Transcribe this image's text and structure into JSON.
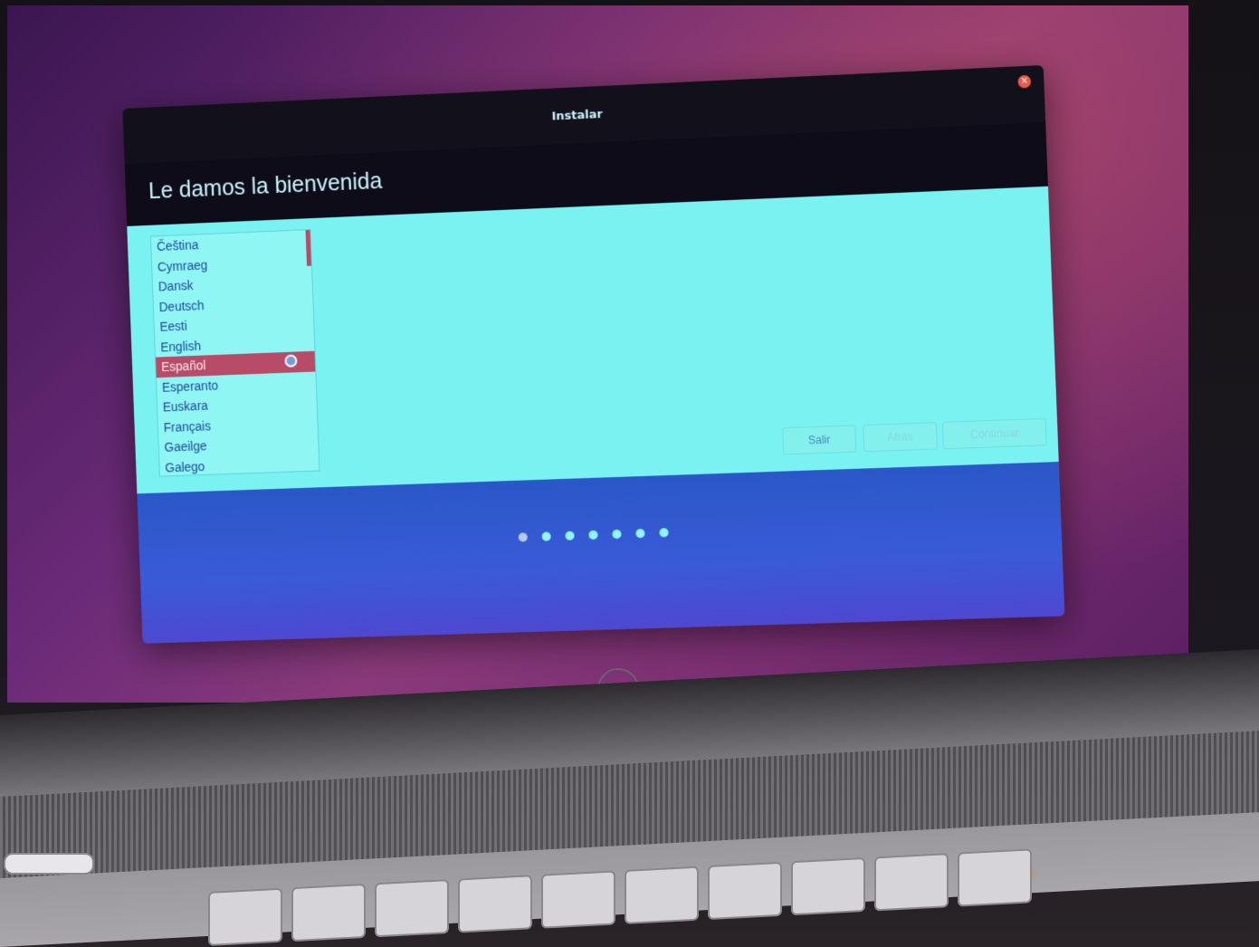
{
  "window": {
    "title": "Instalar",
    "heading": "Le damos la bienvenida"
  },
  "languages": [
    "Čeština",
    "Cymraeg",
    "Dansk",
    "Deutsch",
    "Eesti",
    "English",
    "Español",
    "Esperanto",
    "Euskara",
    "Français",
    "Gaeilge",
    "Galego"
  ],
  "selected_language": "Español",
  "buttons": {
    "quit": "Salir",
    "back": "Atrás",
    "continue": "Continuar"
  },
  "progress": {
    "total_steps": 7,
    "current_step": 1
  },
  "colors": {
    "accent": "#b84c68",
    "content_bg": "#7af2f2",
    "titlebar": "#12101a"
  },
  "icons": [
    "close-icon",
    "cursor-icon"
  ]
}
